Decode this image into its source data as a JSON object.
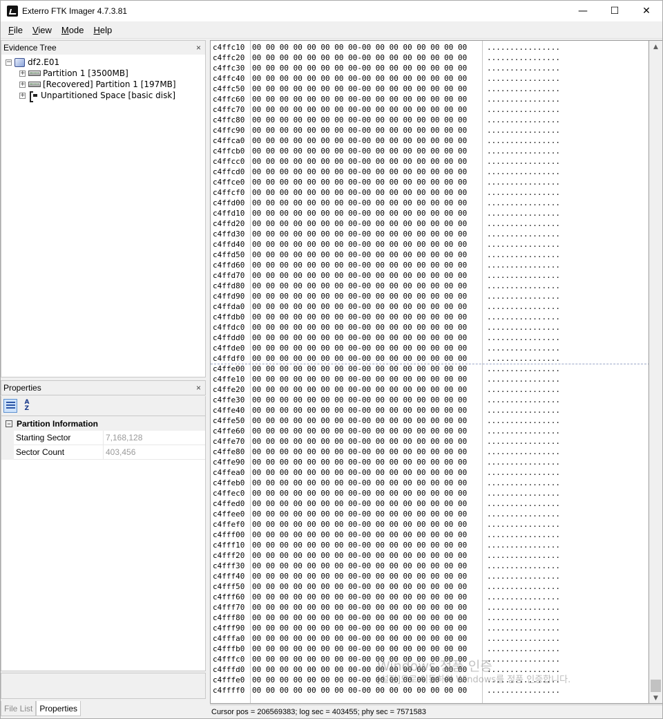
{
  "window": {
    "title": "Exterro FTK Imager 4.7.3.81",
    "controls": {
      "minimize": "—",
      "maximize": "☐",
      "close": "✕"
    }
  },
  "menu": [
    {
      "label": "File",
      "accel": "F",
      "rest": "ile"
    },
    {
      "label": "View",
      "accel": "V",
      "rest": "iew"
    },
    {
      "label": "Mode",
      "accel": "M",
      "rest": "ode"
    },
    {
      "label": "Help",
      "accel": "H",
      "rest": "elp"
    }
  ],
  "evidence_tree": {
    "title": "Evidence Tree",
    "close": "×",
    "root": {
      "label": "df2.E01",
      "expander": "−",
      "icon": "evidence-image-icon"
    },
    "children": [
      {
        "label": "Partition 1 [3500MB]",
        "expander": "+",
        "icon": "drive-icon"
      },
      {
        "label": "[Recovered] Partition 1 [197MB]",
        "expander": "+",
        "icon": "drive-icon"
      },
      {
        "label": "Unpartitioned Space [basic disk]",
        "expander": "+",
        "icon": "unpartitioned-icon"
      }
    ]
  },
  "properties": {
    "title": "Properties",
    "close": "×",
    "category": {
      "label": "Partition Information",
      "toggle": "−"
    },
    "rows": [
      {
        "name": "Starting Sector",
        "value": "7,168,128"
      },
      {
        "name": "Sector Count",
        "value": "403,456"
      }
    ]
  },
  "bottom_tabs": [
    {
      "label": "File List",
      "active": false
    },
    {
      "label": "Properties",
      "active": true
    }
  ],
  "hex": {
    "offsets": [
      "c4ffc10",
      "c4ffc20",
      "c4ffc30",
      "c4ffc40",
      "c4ffc50",
      "c4ffc60",
      "c4ffc70",
      "c4ffc80",
      "c4ffc90",
      "c4ffca0",
      "c4ffcb0",
      "c4ffcc0",
      "c4ffcd0",
      "c4ffce0",
      "c4ffcf0",
      "c4ffd00",
      "c4ffd10",
      "c4ffd20",
      "c4ffd30",
      "c4ffd40",
      "c4ffd50",
      "c4ffd60",
      "c4ffd70",
      "c4ffd80",
      "c4ffd90",
      "c4ffda0",
      "c4ffdb0",
      "c4ffdc0",
      "c4ffdd0",
      "c4ffde0",
      "c4ffdf0",
      "c4ffe00",
      "c4ffe10",
      "c4ffe20",
      "c4ffe30",
      "c4ffe40",
      "c4ffe50",
      "c4ffe60",
      "c4ffe70",
      "c4ffe80",
      "c4ffe90",
      "c4ffea0",
      "c4ffeb0",
      "c4ffec0",
      "c4ffed0",
      "c4ffee0",
      "c4ffef0",
      "c4fff00",
      "c4fff10",
      "c4fff20",
      "c4fff30",
      "c4fff40",
      "c4fff50",
      "c4fff60",
      "c4fff70",
      "c4fff80",
      "c4fff90",
      "c4fffa0",
      "c4fffb0",
      "c4fffc0",
      "c4fffd0",
      "c4fffe0",
      "c4ffff0"
    ],
    "bytes": "00 00 00 00 00 00 00 00-00 00 00 00 00 00 00 00",
    "ascii": "................"
  },
  "status": "Cursor pos = 206569383; log sec = 403455; phy sec = 7571583",
  "watermark": {
    "line1": "Windows 정품 인증",
    "line2": "[설정]으로 이동하여 Windows를 정품 인증합니다."
  },
  "scrollbar": {
    "up": "▲",
    "down": "▼"
  },
  "colors": {
    "accent": "#cfe3fb",
    "panel": "#f0f0f0",
    "sector_divider": "#9aa6c8"
  }
}
